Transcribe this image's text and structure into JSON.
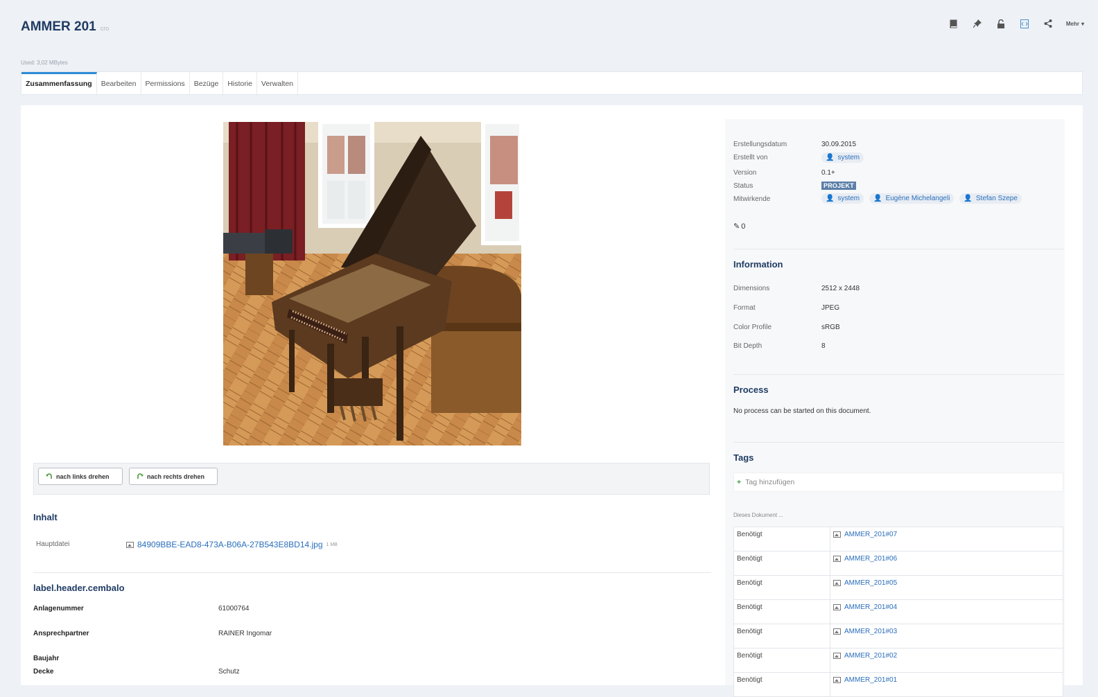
{
  "header": {
    "title": "AMMER 201",
    "title_suffix": "cro",
    "used": "Used: 3,02 MBytes",
    "more_label": "Mehr"
  },
  "tabs": [
    {
      "label": "Zusammenfassung",
      "active": true
    },
    {
      "label": "Bearbeiten"
    },
    {
      "label": "Permissions"
    },
    {
      "label": "Bezüge"
    },
    {
      "label": "Historie"
    },
    {
      "label": "Verwalten"
    }
  ],
  "rotate": {
    "left_label": "nach links drehen",
    "right_label": "nach rechts drehen"
  },
  "inhalt": {
    "title": "Inhalt",
    "main_file_label": "Hauptdatei",
    "main_file_name": "84909BBE-EAD8-473A-B06A-27B543E8BD14.jpg",
    "main_file_size": "1 MB"
  },
  "cembalo": {
    "title": "label.header.cembalo",
    "fields": [
      {
        "label": "Anlagenummer",
        "value": "61000764"
      },
      {
        "label": "Ansprechpartner",
        "value": "RAINER Ingomar"
      },
      {
        "label": "Baujahr",
        "value": ""
      },
      {
        "label": "Decke",
        "value": "Schutz"
      }
    ]
  },
  "meta": {
    "created_label": "Erstellungsdatum",
    "created_value": "30.09.2015",
    "created_by_label": "Erstellt von",
    "created_by": "system",
    "version_label": "Version",
    "version_value": "0.1+",
    "status_label": "Status",
    "status_value": "PROJEKT",
    "contributors_label": "Mitwirkende",
    "contributors": [
      "system",
      "Eugène Michelangeli",
      "Stefan Szepe"
    ],
    "edits_count": "0"
  },
  "information": {
    "title": "Information",
    "rows": [
      {
        "label": "Dimensions",
        "value": "2512 x 2448"
      },
      {
        "label": "Format",
        "value": "JPEG"
      },
      {
        "label": "Color Profile",
        "value": "sRGB"
      },
      {
        "label": "Bit Depth",
        "value": "8"
      }
    ]
  },
  "process": {
    "title": "Process",
    "text": "No process can be started on this document."
  },
  "tags": {
    "title": "Tags",
    "add_label": "Tag hinzufügen"
  },
  "relations": {
    "caption": "Dieses Dokument ...",
    "rows": [
      {
        "kind": "Benötigt",
        "doc": "AMMER_201#07"
      },
      {
        "kind": "Benötigt",
        "doc": "AMMER_201#06"
      },
      {
        "kind": "Benötigt",
        "doc": "AMMER_201#05"
      },
      {
        "kind": "Benötigt",
        "doc": "AMMER_201#04"
      },
      {
        "kind": "Benötigt",
        "doc": "AMMER_201#03"
      },
      {
        "kind": "Benötigt",
        "doc": "AMMER_201#02"
      },
      {
        "kind": "Benötigt",
        "doc": "AMMER_201#01"
      }
    ]
  },
  "icons": {
    "toolbar": [
      "book-icon",
      "pin-icon",
      "lock-icon",
      "code-icon",
      "share-icon"
    ],
    "accent": "#2b8ad6",
    "title_color": "#1f3b63",
    "link_color": "#2a6ebb"
  }
}
